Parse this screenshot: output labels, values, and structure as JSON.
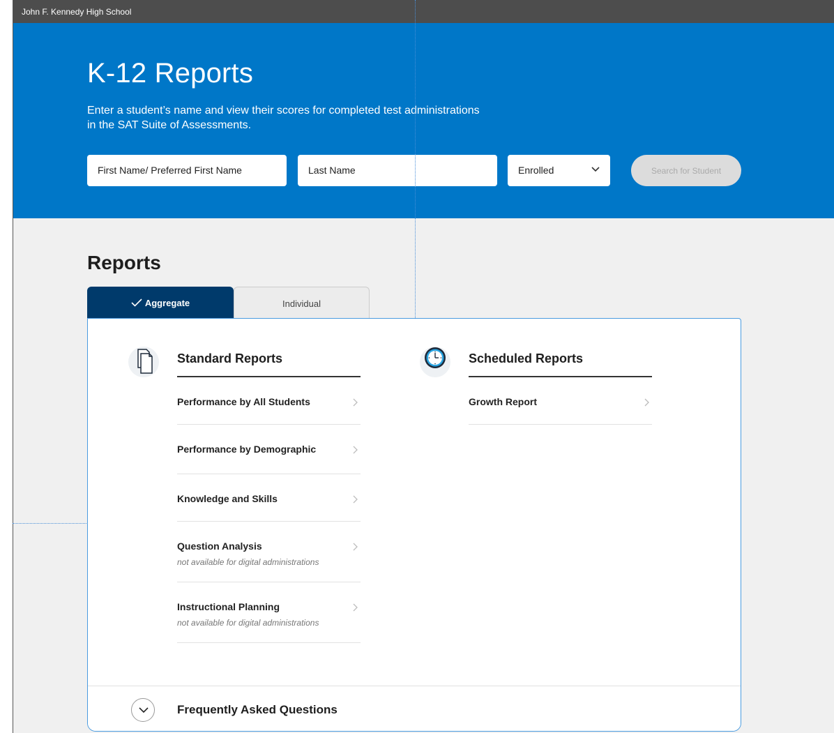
{
  "topbar": {
    "school": "John F. Kennedy High School"
  },
  "hero": {
    "title": "K-12 Reports",
    "description_line1": "Enter a student’s name and view their scores for completed test administrations",
    "description_line2": "in the SAT Suite of Assessments."
  },
  "search": {
    "first_name_placeholder": "First Name/ Preferred First Name",
    "last_name_placeholder": "Last Name",
    "status_selected": "Enrolled",
    "button_label": "Search for Student"
  },
  "reports": {
    "title": "Reports",
    "tabs": [
      {
        "label": "Aggregate",
        "active": true
      },
      {
        "label": "Individual",
        "active": false
      }
    ]
  },
  "standard_reports": {
    "title": "Standard Reports",
    "icon": "documents-icon",
    "items": [
      {
        "label": "Performance by All Students",
        "note": ""
      },
      {
        "label": "Performance by Demographic",
        "note": ""
      },
      {
        "label": "Knowledge and Skills",
        "note": ""
      },
      {
        "label": "Question Analysis",
        "note": "not available for digital administrations"
      },
      {
        "label": "Instructional Planning",
        "note": "not available for digital administrations"
      }
    ]
  },
  "scheduled_reports": {
    "title": "Scheduled Reports",
    "icon": "clock-icon",
    "items": [
      {
        "label": "Growth Report"
      }
    ]
  },
  "faq": {
    "label": "Frequently Asked Questions"
  },
  "colors": {
    "hero_blue": "#0077c8",
    "tab_active": "#003a6b",
    "topbar": "#4d4d4d"
  }
}
